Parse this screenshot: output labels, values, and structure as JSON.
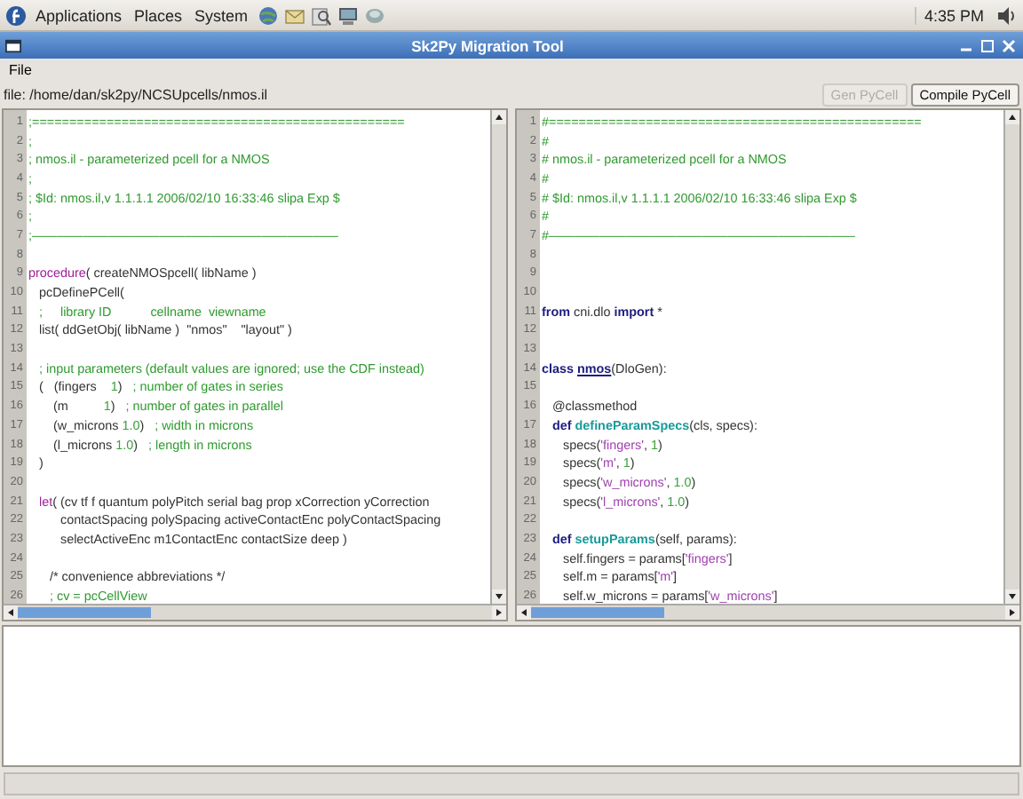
{
  "panel": {
    "menus": [
      "Applications",
      "Places",
      "System"
    ],
    "clock": "4:35 PM"
  },
  "window": {
    "title": "Sk2Py Migration Tool"
  },
  "menu": [
    "File"
  ],
  "file_bar": {
    "path": "file: /home/dan/sk2py/NCSUpcells/nmos.il",
    "buttons": [
      {
        "label": "Gen PyCell",
        "disabled": true
      },
      {
        "label": "Compile PyCell",
        "disabled": false
      }
    ]
  },
  "editors": [
    {
      "lines": [
        {
          "n": "1",
          "s": [
            {
              "kind": "c",
              "text": ";=================================================="
            }
          ]
        },
        {
          "n": "2",
          "s": [
            {
              "kind": "c",
              "text": ";"
            }
          ]
        },
        {
          "n": "3",
          "s": [
            {
              "kind": "c",
              "text": "; nmos.il - parameterized pcell for a NMOS"
            }
          ]
        },
        {
          "n": "4",
          "s": [
            {
              "kind": "c",
              "text": ";"
            }
          ]
        },
        {
          "n": "5",
          "s": [
            {
              "kind": "c",
              "text": "; $Id: nmos.il,v 1.1.1.1 2006/02/10 16:33:46 slipa Exp $"
            }
          ]
        },
        {
          "n": "6",
          "s": [
            {
              "kind": "c",
              "text": ";"
            }
          ]
        },
        {
          "n": "7",
          "s": [
            {
              "kind": "c",
              "text": ";————————————————————————"
            }
          ]
        },
        {
          "n": "8"
        },
        {
          "n": "9",
          "s": [
            {
              "kind": "kp",
              "text": "procedure"
            },
            {
              "kind": "p",
              "text": "( createNMOSpcell( libName )"
            }
          ]
        },
        {
          "n": "10",
          "s": [
            {
              "kind": "p",
              "text": "   pcDefinePCell("
            }
          ]
        },
        {
          "n": "11",
          "s": [
            {
              "kind": "c",
              "text": "   ;     library ID           cellname  viewname"
            }
          ]
        },
        {
          "n": "12",
          "s": [
            {
              "kind": "p",
              "text": "   list( ddGetObj( libName )  \"nmos\"    \"layout\" )"
            }
          ]
        },
        {
          "n": "13"
        },
        {
          "n": "14",
          "s": [
            {
              "kind": "c",
              "text": "   ; input parameters (default values are ignored; use the CDF instead)"
            }
          ]
        },
        {
          "n": "15",
          "s": [
            {
              "kind": "p",
              "text": "   (   (fingers    "
            },
            {
              "kind": "n",
              "text": "1"
            },
            {
              "kind": "p",
              "text": ")   "
            },
            {
              "kind": "c",
              "text": "; number of gates in series"
            }
          ]
        },
        {
          "n": "16",
          "s": [
            {
              "kind": "p",
              "text": "       (m          "
            },
            {
              "kind": "n",
              "text": "1"
            },
            {
              "kind": "p",
              "text": ")   "
            },
            {
              "kind": "c",
              "text": "; number of gates in parallel"
            }
          ]
        },
        {
          "n": "17",
          "s": [
            {
              "kind": "p",
              "text": "       (w_microns "
            },
            {
              "kind": "n",
              "text": "1.0"
            },
            {
              "kind": "p",
              "text": ")   "
            },
            {
              "kind": "c",
              "text": "; width in microns"
            }
          ]
        },
        {
          "n": "18",
          "s": [
            {
              "kind": "p",
              "text": "       (l_microns "
            },
            {
              "kind": "n",
              "text": "1.0"
            },
            {
              "kind": "p",
              "text": ")   "
            },
            {
              "kind": "c",
              "text": "; length in microns"
            }
          ]
        },
        {
          "n": "19",
          "s": [
            {
              "kind": "p",
              "text": "   )"
            }
          ]
        },
        {
          "n": "20"
        },
        {
          "n": "21",
          "s": [
            {
              "kind": "kp",
              "text": "   let"
            },
            {
              "kind": "p",
              "text": "( (cv tf f quantum polyPitch serial bag prop xCorrection yCorrection"
            }
          ]
        },
        {
          "n": "22",
          "s": [
            {
              "kind": "p",
              "text": "         contactSpacing polySpacing activeContactEnc polyContactSpacing"
            }
          ]
        },
        {
          "n": "23",
          "s": [
            {
              "kind": "p",
              "text": "         selectActiveEnc m1ContactEnc contactSize deep )"
            }
          ]
        },
        {
          "n": "24"
        },
        {
          "n": "25",
          "s": [
            {
              "kind": "p",
              "text": "      /* convenience abbreviations */"
            }
          ]
        },
        {
          "n": "26",
          "s": [
            {
              "kind": "c",
              "text": "      ; cv = pcCellView"
            }
          ]
        }
      ]
    },
    {
      "lines": [
        {
          "n": "1",
          "s": [
            {
              "kind": "c",
              "text": "#=================================================="
            }
          ]
        },
        {
          "n": "2",
          "s": [
            {
              "kind": "c",
              "text": "#"
            }
          ]
        },
        {
          "n": "3",
          "s": [
            {
              "kind": "c",
              "text": "# nmos.il - parameterized pcell for a NMOS"
            }
          ]
        },
        {
          "n": "4",
          "s": [
            {
              "kind": "c",
              "text": "#"
            }
          ]
        },
        {
          "n": "5",
          "s": [
            {
              "kind": "c",
              "text": "# $Id: nmos.il,v 1.1.1.1 2006/02/10 16:33:46 slipa Exp $"
            }
          ]
        },
        {
          "n": "6",
          "s": [
            {
              "kind": "c",
              "text": "#"
            }
          ]
        },
        {
          "n": "7",
          "s": [
            {
              "kind": "c",
              "text": "#————————————————————————"
            }
          ]
        },
        {
          "n": "8"
        },
        {
          "n": "9"
        },
        {
          "n": "10"
        },
        {
          "n": "11",
          "s": [
            {
              "kind": "kb",
              "text": "from"
            },
            {
              "kind": "p",
              "text": " cni.dlo "
            },
            {
              "kind": "kb",
              "text": "import"
            },
            {
              "kind": "p",
              "text": " *"
            }
          ]
        },
        {
          "n": "12"
        },
        {
          "n": "13"
        },
        {
          "n": "14",
          "s": [
            {
              "kind": "kb",
              "text": "class "
            },
            {
              "kind": "u",
              "text": "nmos"
            },
            {
              "kind": "p",
              "text": "(DloGen):"
            }
          ]
        },
        {
          "n": "15"
        },
        {
          "n": "16",
          "s": [
            {
              "kind": "p",
              "text": "   @classmethod"
            }
          ]
        },
        {
          "n": "17",
          "s": [
            {
              "kind": "kb",
              "text": "   def "
            },
            {
              "kind": "f",
              "text": "defineParamSpecs"
            },
            {
              "kind": "p",
              "text": "(cls, specs):"
            }
          ]
        },
        {
          "n": "18",
          "s": [
            {
              "kind": "p",
              "text": "      specs("
            },
            {
              "kind": "s",
              "text": "'fingers'"
            },
            {
              "kind": "p",
              "text": ", "
            },
            {
              "kind": "n",
              "text": "1"
            },
            {
              "kind": "p",
              "text": ")"
            }
          ]
        },
        {
          "n": "19",
          "s": [
            {
              "kind": "p",
              "text": "      specs("
            },
            {
              "kind": "s",
              "text": "'m'"
            },
            {
              "kind": "p",
              "text": ", "
            },
            {
              "kind": "n",
              "text": "1"
            },
            {
              "kind": "p",
              "text": ")"
            }
          ]
        },
        {
          "n": "20",
          "s": [
            {
              "kind": "p",
              "text": "      specs("
            },
            {
              "kind": "s",
              "text": "'w_microns'"
            },
            {
              "kind": "p",
              "text": ", "
            },
            {
              "kind": "n",
              "text": "1.0"
            },
            {
              "kind": "p",
              "text": ")"
            }
          ]
        },
        {
          "n": "21",
          "s": [
            {
              "kind": "p",
              "text": "      specs("
            },
            {
              "kind": "s",
              "text": "'l_microns'"
            },
            {
              "kind": "p",
              "text": ", "
            },
            {
              "kind": "n",
              "text": "1.0"
            },
            {
              "kind": "p",
              "text": ")"
            }
          ]
        },
        {
          "n": "22"
        },
        {
          "n": "23",
          "s": [
            {
              "kind": "kb",
              "text": "   def "
            },
            {
              "kind": "f",
              "text": "setupParams"
            },
            {
              "kind": "p",
              "text": "(self, params):"
            }
          ]
        },
        {
          "n": "24",
          "s": [
            {
              "kind": "p",
              "text": "      self.fingers = params["
            },
            {
              "kind": "s",
              "text": "'fingers'"
            },
            {
              "kind": "p",
              "text": "]"
            }
          ]
        },
        {
          "n": "25",
          "s": [
            {
              "kind": "p",
              "text": "      self.m = params["
            },
            {
              "kind": "s",
              "text": "'m'"
            },
            {
              "kind": "p",
              "text": "]"
            }
          ]
        },
        {
          "n": "26",
          "s": [
            {
              "kind": "p",
              "text": "      self.w_microns = params["
            },
            {
              "kind": "s",
              "text": "'w_microns'"
            },
            {
              "kind": "p",
              "text": "]"
            }
          ]
        }
      ]
    }
  ]
}
